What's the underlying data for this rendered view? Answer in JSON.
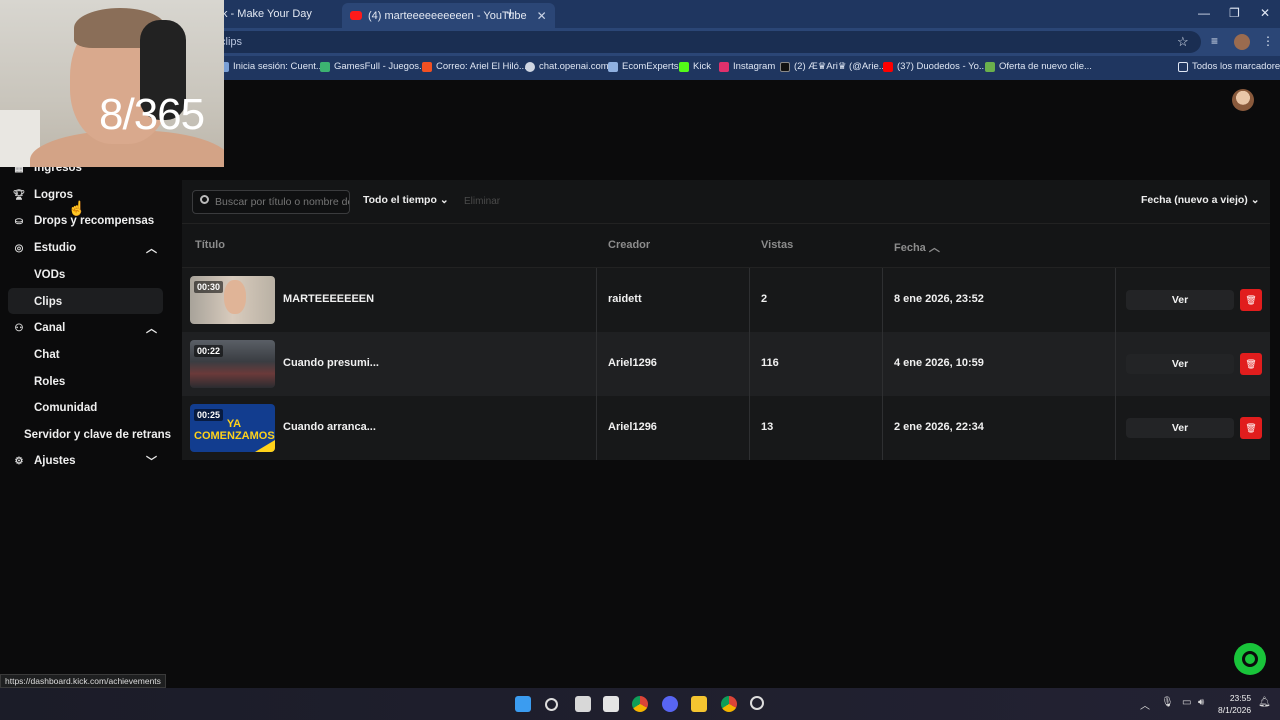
{
  "browser": {
    "tabs": [
      {
        "label": "k - Make Your Day"
      },
      {
        "label": "(4) marteeeeeeeeeen - YouTube"
      }
    ],
    "url": "clips",
    "bookmarks": [
      {
        "label": "Inicia sesión: Cuent...",
        "color": "#7aa0d6"
      },
      {
        "label": "GamesFull - Juegos...",
        "color": "#3cb371"
      },
      {
        "label": "Correo: Ariel El Hiló...",
        "color": "#f25022"
      },
      {
        "label": "chat.openai.com",
        "color": "#cfd6e2"
      },
      {
        "label": "EcomExperts",
        "color": "#8fb0e0"
      },
      {
        "label": "Kick",
        "color": "#53fc18"
      },
      {
        "label": "Instagram",
        "color": "#e1306c"
      },
      {
        "label": "(2) Æ♛Ari♛ (@Arie...",
        "color": "#111111"
      },
      {
        "label": "(37) Duodedos - Yo...",
        "color": "#ff0000"
      },
      {
        "label": "Oferta de nuevo clie...",
        "color": "#6ab04c"
      }
    ],
    "all_bookmarks": "Todos los marcadores"
  },
  "overlay": {
    "counter": "8/365"
  },
  "sidebar": {
    "items": [
      {
        "label": "Ingresos",
        "icon": "building-icon"
      },
      {
        "label": "Logros",
        "icon": "trophy-icon"
      },
      {
        "label": "Drops y recompensas",
        "icon": "gift-icon"
      },
      {
        "label": "Estudio",
        "icon": "studio-icon"
      },
      {
        "label": "Canal",
        "icon": "channel-icon"
      },
      {
        "label": "Ajustes",
        "icon": "gear-icon"
      }
    ],
    "studio_sub": [
      "VODs",
      "Clips"
    ],
    "canal_sub": [
      "Chat",
      "Roles",
      "Comunidad"
    ],
    "server_key": "Servidor y clave de retrans"
  },
  "toolbar": {
    "search_placeholder": "Buscar por título o nombre de",
    "time_filter": "Todo el tiempo",
    "disabled_action": "Eliminar",
    "sort": "Fecha (nuevo a viejo)"
  },
  "table": {
    "headers": {
      "title": "Título",
      "creator": "Creador",
      "views": "Vistas",
      "date": "Fecha"
    },
    "rows": [
      {
        "duration": "00:30",
        "title": "MARTEEEEEEEN",
        "creator": "raidett",
        "views": "2",
        "date": "8 ene 2026, 23:52",
        "action": "Ver"
      },
      {
        "duration": "00:22",
        "title": "Cuando presumi...",
        "creator": "Ariel1296",
        "views": "116",
        "date": "4 ene 2026, 10:59",
        "action": "Ver"
      },
      {
        "duration": "00:25",
        "title": "Cuando arranca...",
        "creator": "Ariel1296",
        "views": "13",
        "date": "2 ene 2026, 22:34",
        "action": "Ver"
      }
    ],
    "thumb3_text": "YA COMENZAMOS"
  },
  "status_url": "https://dashboard.kick.com/achievements",
  "taskbar": {
    "time": "23:55",
    "date": "8/1/2026"
  },
  "colors": {
    "accent": "#53fc18",
    "danger": "#e11d1d",
    "background": "#0b0b0c"
  }
}
